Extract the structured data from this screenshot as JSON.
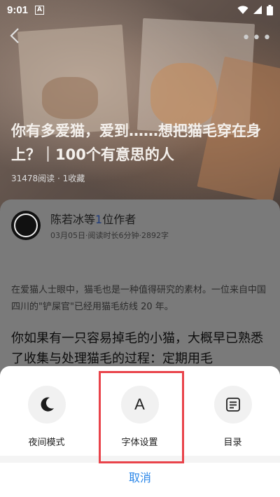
{
  "statusbar": {
    "time": "9:01",
    "badge": "A"
  },
  "header": {
    "back_icon": "chevron-left-icon",
    "more_icon": "more-icon",
    "more_glyph": "•••"
  },
  "article": {
    "title": "你有多爱猫，爱到……想把猫毛穿在身上？｜100个有意思的人",
    "meta": "31478阅读 · 1收藏"
  },
  "author": {
    "name_prefix": "陈若冰等",
    "name_count": "1",
    "name_suffix": "位作者",
    "subline": "03月05日·阅读时长6分钟·2892字"
  },
  "content": {
    "quote": "在爱猫人士眼中，猫毛也是一种值得研究的素材。一位来自中国四川的\"铲屎官\"已经用猫毛纺线 20 年。",
    "body": "你如果有一只容易掉毛的小猫，大概早已熟悉了收集与处理猫毛的过程：定期用毛"
  },
  "sheet": {
    "options": [
      {
        "label": "夜间模式",
        "icon": "moon-icon"
      },
      {
        "label": "字体设置",
        "icon": "font-icon",
        "glyph": "A"
      },
      {
        "label": "目录",
        "icon": "list-icon"
      }
    ],
    "cancel_label": "取消"
  },
  "colors": {
    "accent": "#2a86e8",
    "highlight": "#e9434a"
  }
}
